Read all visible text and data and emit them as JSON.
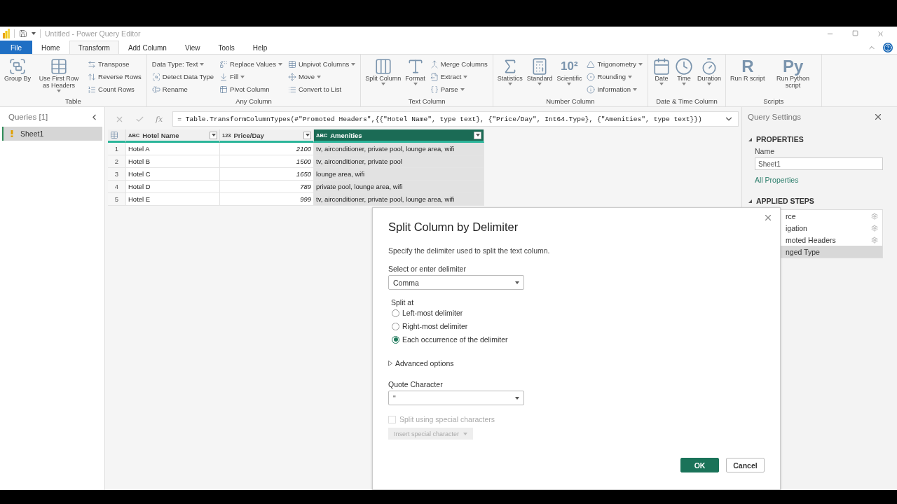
{
  "window": {
    "title": "Untitled - Power Query Editor"
  },
  "tabs": [
    {
      "label": "File",
      "kind": "file",
      "selected": false
    },
    {
      "label": "Home",
      "kind": "tab",
      "selected": false
    },
    {
      "label": "Transform",
      "kind": "tab",
      "selected": true
    },
    {
      "label": "Add Column",
      "kind": "tab",
      "selected": false
    },
    {
      "label": "View",
      "kind": "tab",
      "selected": false
    },
    {
      "label": "Tools",
      "kind": "tab",
      "selected": false
    },
    {
      "label": "Help",
      "kind": "tab",
      "selected": false
    }
  ],
  "ribbon": [
    {
      "label": "Table",
      "columns": [
        {
          "kind": "large",
          "items": [
            {
              "label": "Group By",
              "menu": false
            }
          ]
        },
        {
          "kind": "large",
          "items": [
            {
              "label": "Use First Row as Headers",
              "menu": true
            }
          ]
        },
        {
          "kind": "small",
          "items": [
            {
              "label": "Transpose",
              "menu": false
            },
            {
              "label": "Reverse Rows",
              "menu": false
            },
            {
              "label": "Count Rows",
              "menu": false
            }
          ]
        }
      ]
    },
    {
      "label": "Any Column",
      "columns": [
        {
          "kind": "small",
          "items": [
            {
              "label": "Data Type: Text",
              "menu": true
            },
            {
              "label": "Detect Data Type",
              "menu": false
            },
            {
              "label": "Rename",
              "menu": false
            }
          ]
        },
        {
          "kind": "small",
          "items": [
            {
              "label": "Replace Values",
              "menu": true
            },
            {
              "label": "Fill",
              "menu": true
            },
            {
              "label": "Pivot Column",
              "menu": false
            }
          ]
        },
        {
          "kind": "small",
          "items": [
            {
              "label": "Unpivot Columns",
              "menu": true
            },
            {
              "label": "Move",
              "menu": true
            },
            {
              "label": "Convert to List",
              "menu": false
            }
          ]
        }
      ]
    },
    {
      "label": "Text Column",
      "columns": [
        {
          "kind": "large",
          "items": [
            {
              "label": "Split Column",
              "menu": true
            }
          ]
        },
        {
          "kind": "large",
          "items": [
            {
              "label": "Format",
              "menu": true
            }
          ]
        },
        {
          "kind": "small",
          "items": [
            {
              "label": "Merge Columns",
              "menu": false
            },
            {
              "label": "Extract",
              "menu": true
            },
            {
              "label": "Parse",
              "menu": true
            }
          ]
        }
      ]
    },
    {
      "label": "Number Column",
      "columns": [
        {
          "kind": "large",
          "items": [
            {
              "label": "Statistics",
              "menu": true
            }
          ]
        },
        {
          "kind": "large",
          "items": [
            {
              "label": "Standard",
              "menu": true
            }
          ]
        },
        {
          "kind": "large",
          "items": [
            {
              "label": "Scientific",
              "menu": true,
              "glyph": "10²"
            }
          ]
        },
        {
          "kind": "small",
          "items": [
            {
              "label": "Trigonometry",
              "menu": true
            },
            {
              "label": "Rounding",
              "menu": true
            },
            {
              "label": "Information",
              "menu": true
            }
          ]
        }
      ]
    },
    {
      "label": "Date & Time Column",
      "columns": [
        {
          "kind": "large",
          "items": [
            {
              "label": "Date",
              "menu": true
            }
          ]
        },
        {
          "kind": "large",
          "items": [
            {
              "label": "Time",
              "menu": true
            }
          ]
        },
        {
          "kind": "large",
          "items": [
            {
              "label": "Duration",
              "menu": true
            }
          ]
        }
      ]
    },
    {
      "label": "Scripts",
      "columns": [
        {
          "kind": "large",
          "items": [
            {
              "label": "Run R script",
              "menu": false,
              "glyph": "R"
            }
          ]
        },
        {
          "kind": "large",
          "items": [
            {
              "label": "Run Python script",
              "menu": false,
              "glyph": "Py"
            }
          ]
        }
      ]
    }
  ],
  "queries": {
    "title": "Queries [1]",
    "items": [
      {
        "label": "Sheet1",
        "selected": true,
        "warning": true
      }
    ]
  },
  "formula_bar": {
    "function_label": "fx",
    "formula": "= Table.TransformColumnTypes(#\"Promoted Headers\",{{\"Hotel Name\", type text}, {\"Price/Day\", Int64.Type}, {\"Amenities\", type text}})"
  },
  "table": {
    "columns": [
      {
        "name": "Hotel Name",
        "type": "ABC",
        "kind": "text",
        "selected": false
      },
      {
        "name": "Price/Day",
        "type": "123",
        "kind": "number",
        "selected": false
      },
      {
        "name": "Amenities",
        "type": "ABC",
        "kind": "text",
        "selected": true
      }
    ],
    "rows": [
      {
        "number": "1",
        "cells": [
          "Hotel A",
          "2100",
          "tv, airconditioner, private pool, lounge area, wifi"
        ]
      },
      {
        "number": "2",
        "cells": [
          "Hotel B",
          "1500",
          "tv, airconditioner, private pool"
        ]
      },
      {
        "number": "3",
        "cells": [
          "Hotel C",
          "1650",
          "lounge area, wifi"
        ]
      },
      {
        "number": "4",
        "cells": [
          "Hotel D",
          "789",
          "private pool, lounge area, wifi"
        ]
      },
      {
        "number": "5",
        "cells": [
          "Hotel E",
          "999",
          "tv, airconditioner, private pool, lounge area, wifi"
        ]
      }
    ]
  },
  "query_settings": {
    "title": "Query Settings",
    "properties": {
      "heading": "PROPERTIES",
      "expanded": true,
      "name_label": "Name",
      "name_value": "Sheet1",
      "link": "All Properties"
    },
    "applied_steps": {
      "heading": "APPLIED STEPS",
      "expanded": true,
      "steps": [
        {
          "label": "rce",
          "settings": true,
          "selected": false
        },
        {
          "label": "igation",
          "settings": true,
          "selected": false
        },
        {
          "label": "moted Headers",
          "settings": true,
          "selected": false
        },
        {
          "label": "nged Type",
          "settings": false,
          "selected": true
        }
      ]
    }
  },
  "dialog": {
    "title": "Split Column by Delimiter",
    "description": "Specify the delimiter used to split the text column.",
    "delimiter": {
      "label": "Select or enter delimiter",
      "value": "Comma"
    },
    "split_at": {
      "label": "Split at",
      "options": [
        {
          "label": "Left-most delimiter",
          "selected": false
        },
        {
          "label": "Right-most delimiter",
          "selected": false
        },
        {
          "label": "Each occurrence of the delimiter",
          "selected": true
        }
      ]
    },
    "advanced": {
      "label": "Advanced options",
      "expanded": false
    },
    "quote": {
      "label": "Quote Character",
      "value": "\""
    },
    "special": {
      "label": "Split using special characters",
      "checked": false,
      "disabled": true
    },
    "insert_button": {
      "label": "Insert special character",
      "disabled": true
    },
    "buttons": [
      {
        "label": "OK",
        "kind": "primary"
      },
      {
        "label": "Cancel",
        "kind": "secondary"
      }
    ]
  }
}
